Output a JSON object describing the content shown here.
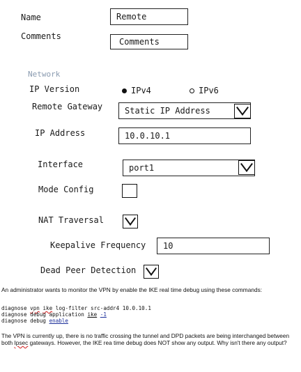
{
  "form": {
    "name_label": "Name",
    "name_value": "Remote",
    "comments_label": "Comments",
    "comments_placeholder": "Comments",
    "network_section": "Network",
    "ip_version_label": "IP Version",
    "ipv4_label": "IPv4",
    "ipv6_label": "IPv6",
    "ip_version_selected": "IPv4",
    "remote_gateway_label": "Remote Gateway",
    "remote_gateway_value": "Static IP Address",
    "ip_address_label": "IP Address",
    "ip_address_value": "10.0.10.1",
    "interface_label": "Interface",
    "interface_value": "port1",
    "mode_config_label": "Mode Config",
    "mode_config_checked": false,
    "nat_traversal_label": "NAT Traversal",
    "nat_traversal_checked": true,
    "keepalive_label": "Keepalive Frequency",
    "keepalive_value": "10",
    "dpd_label": "Dead Peer Detection",
    "dpd_checked": true
  },
  "question": {
    "intro": "An administrator wants to monitor the VPN by enable the IKE real time debug using these commands:",
    "cmd1_a": "diagnose ",
    "cmd1_b": "vpn",
    "cmd1_c": " ",
    "cmd1_d": "ike",
    "cmd1_e": " log-filter src-addr4 10.0.10.1",
    "cmd2_a": "diagnose debug application ",
    "cmd2_b": "ike",
    "cmd2_c": " ",
    "cmd2_d": "-1",
    "cmd3_a": "diagnose debug ",
    "cmd3_b": "enable",
    "body_a": "The VPN is currently up, there is no traffic crossing the tunnel and DPD packets are being interchanged between both ",
    "body_b": "Ipsec",
    "body_c": " gateways. However, the IKE rea time debug does NOT show any output. Why isn't there any output?"
  }
}
